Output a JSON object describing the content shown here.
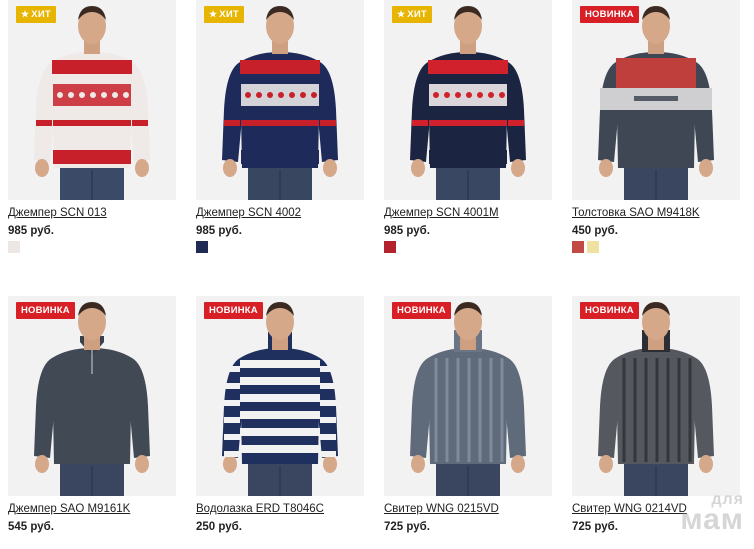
{
  "products": [
    {
      "name": "Джемпер SCN 013",
      "price": "985 руб.",
      "badge": "ХИТ",
      "badge_type": "hit",
      "badge_icon": "star-icon",
      "swatches": [
        "#ece7e4"
      ],
      "colors": {
        "body": "#efe9e7",
        "band": "#c8202a",
        "accent": "#1b2b55",
        "sleeve": "#efe9e7",
        "pants": "#3b4a66"
      }
    },
    {
      "name": "Джемпер SCN 4002",
      "price": "985 руб.",
      "badge": "ХИТ",
      "badge_type": "hit",
      "badge_icon": "star-icon",
      "swatches": [
        "#1f2a55"
      ],
      "colors": {
        "body": "#1d2a5a",
        "band": "#c8202a",
        "accent": "#e9e6e6",
        "sleeve": "#1d2a5a",
        "pants": "#394660"
      }
    },
    {
      "name": "Джемпер SCN 4001М",
      "price": "985 руб.",
      "badge": "ХИТ",
      "badge_type": "hit",
      "badge_icon": "star-icon",
      "swatches": [
        "#b3232d"
      ],
      "colors": {
        "body": "#1b2440",
        "band": "#d0212c",
        "accent": "#efeaea",
        "sleeve": "#1b2440",
        "pants": "#3a4763"
      }
    },
    {
      "name": "Толстовка SAO M9418K",
      "price": "450 руб.",
      "badge": "НОВИНКА",
      "badge_type": "new",
      "badge_icon": "",
      "swatches": [
        "#c24a45",
        "#efe2a1"
      ],
      "colors": {
        "body": "#3f4654",
        "band": "#bf3f3c",
        "accent": "#cfcfd1",
        "sleeve": "#3f4654",
        "pants": "#3a4560"
      }
    },
    {
      "name": "Джемпер SAO M9161K",
      "price": "545 руб.",
      "badge": "НОВИНКА",
      "badge_type": "new",
      "badge_icon": "",
      "swatches": [],
      "colors": {
        "body": "#414955",
        "band": "#414955",
        "accent": "#4a525f",
        "sleeve": "#414955",
        "pants": "#3a4560"
      }
    },
    {
      "name": "Водолазка ERD T8046C",
      "price": "250 руб.",
      "badge": "НОВИНКА",
      "badge_type": "new",
      "badge_icon": "",
      "swatches": [],
      "colors": {
        "body": "#20305e",
        "band": "#f2f2f2",
        "accent": "#20305e",
        "sleeve": "#20305e",
        "pants": "#3a4560"
      }
    },
    {
      "name": "Свитер WNG 0215VD",
      "price": "725 руб.",
      "badge": "НОВИНКА",
      "badge_type": "new",
      "badge_icon": "",
      "swatches": [],
      "colors": {
        "body": "#5f6a7a",
        "band": "#6b7585",
        "accent": "#8893a2",
        "sleeve": "#5f6a7a",
        "pants": "#3a4560"
      }
    },
    {
      "name": "Свитер WNG 0214VD",
      "price": "725 руб.",
      "badge": "НОВИНКА",
      "badge_type": "new",
      "badge_icon": "",
      "swatches": [],
      "colors": {
        "body": "#55595f",
        "band": "#8a8d91",
        "accent": "#2b2e33",
        "sleeve": "#55595f",
        "pants": "#3a4560"
      }
    }
  ],
  "watermark": {
    "line1": "для",
    "line2": "мам"
  }
}
